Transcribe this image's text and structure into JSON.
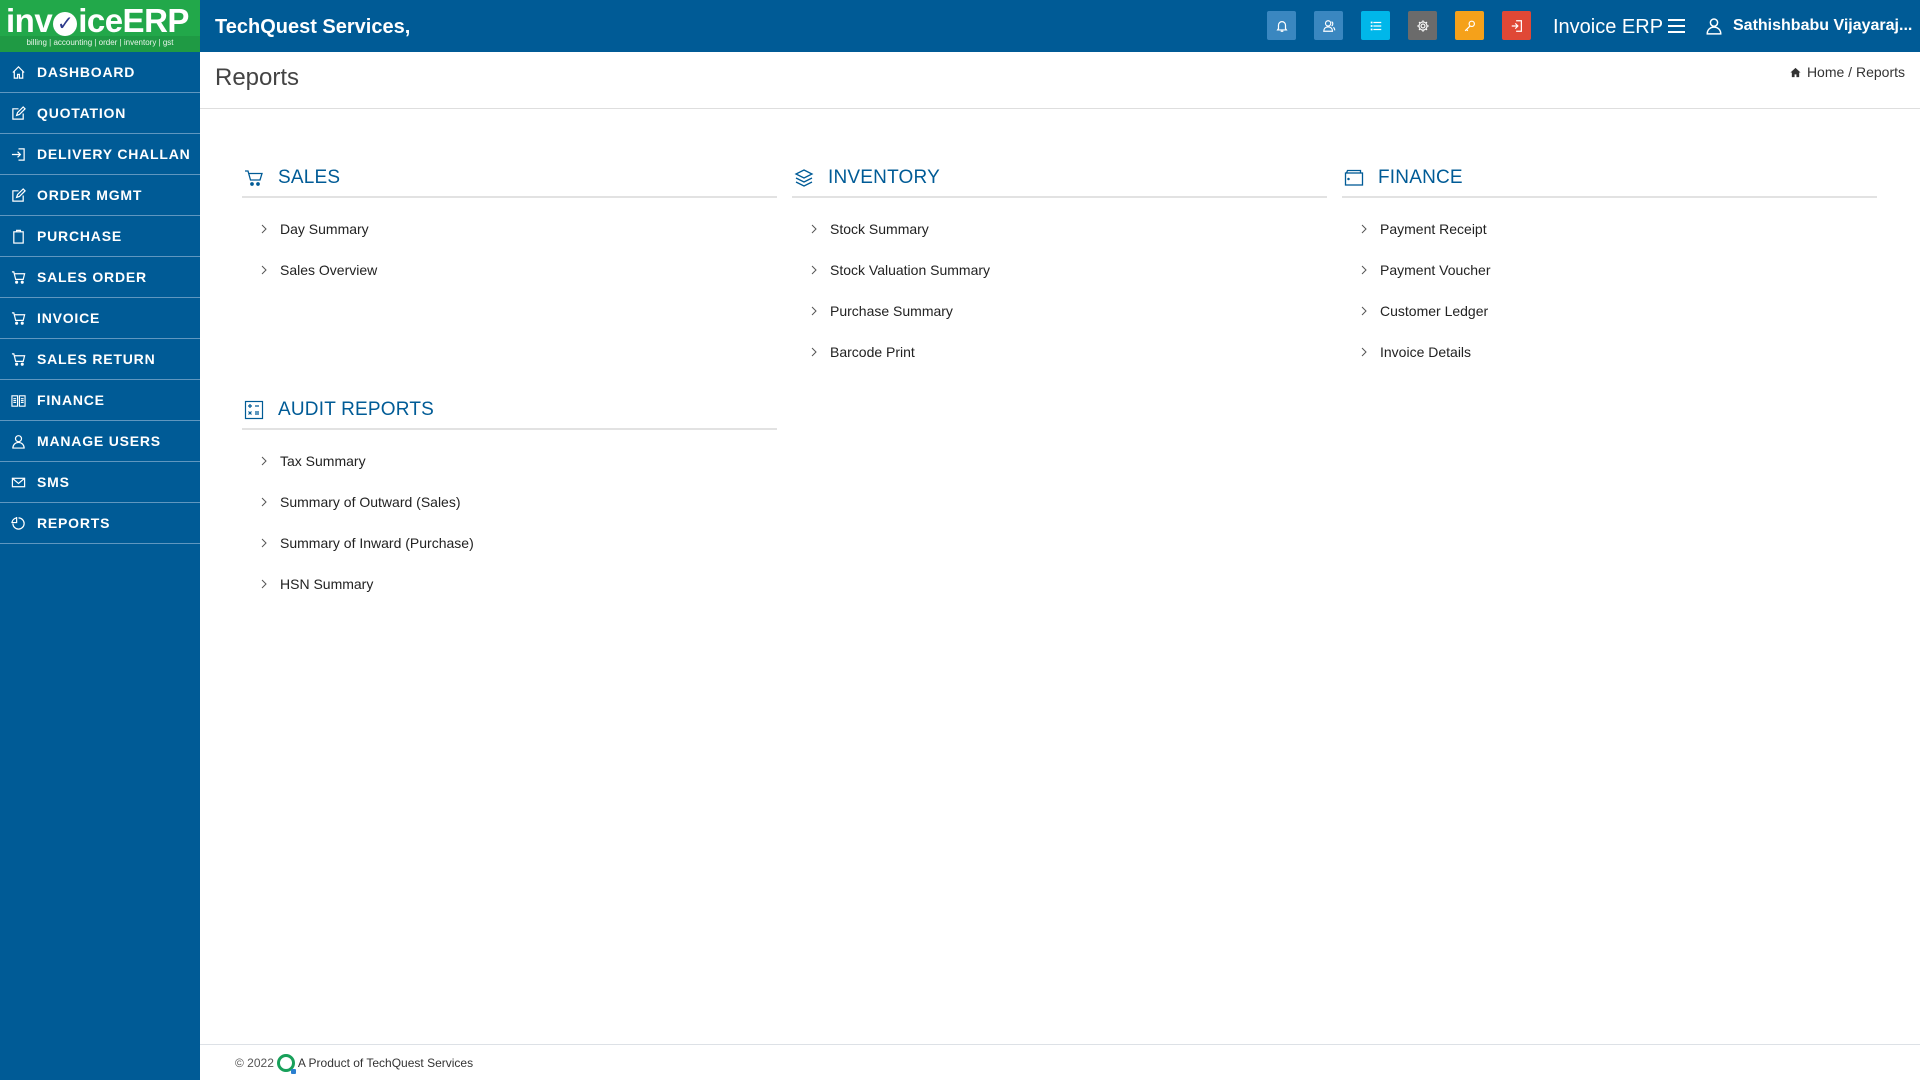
{
  "header": {
    "logo": {
      "main": "invoiceERP",
      "tagline": "billing | accounting | order | inventory | gst"
    },
    "company": "TechQuest Services,",
    "toolbar": [
      {
        "name": "notifications-button",
        "icon": "bell-icon",
        "color": "#3a87c0"
      },
      {
        "name": "users-button",
        "icon": "users-icon",
        "color": "#3a87c0"
      },
      {
        "name": "list-button",
        "icon": "list-icon",
        "color": "#00b7ea"
      },
      {
        "name": "settings-button",
        "icon": "gear-icon",
        "color": "#6b6b6b"
      },
      {
        "name": "password-button",
        "icon": "key-icon",
        "color": "#f5a11a"
      },
      {
        "name": "logout-button",
        "icon": "logout-icon",
        "color": "#e04836"
      }
    ],
    "app_name": "Invoice ERP",
    "user_name": "Sathishbabu Vijayaraj..."
  },
  "sidebar": {
    "items": [
      {
        "label": "DASHBOARD",
        "icon": "home-icon"
      },
      {
        "label": "QUOTATION",
        "icon": "edit-icon"
      },
      {
        "label": "DELIVERY CHALLAN",
        "icon": "sign-in-icon"
      },
      {
        "label": "ORDER MGMT",
        "icon": "edit-icon"
      },
      {
        "label": "PURCHASE",
        "icon": "clipboard-icon"
      },
      {
        "label": "SALES ORDER",
        "icon": "cart-icon"
      },
      {
        "label": "INVOICE",
        "icon": "cart-icon"
      },
      {
        "label": "SALES RETURN",
        "icon": "cart-icon"
      },
      {
        "label": "FINANCE",
        "icon": "book-icon"
      },
      {
        "label": "MANAGE USERS",
        "icon": "user-icon"
      },
      {
        "label": "SMS",
        "icon": "envelope-icon"
      },
      {
        "label": "REPORTS",
        "icon": "pie-chart-icon"
      }
    ]
  },
  "page": {
    "title": "Reports",
    "breadcrumb": {
      "home": "Home",
      "separator": " / ",
      "current": "Reports"
    }
  },
  "sections": {
    "sales": {
      "title": "SALES",
      "icon": "cart-icon",
      "items": [
        "Day Summary",
        "Sales Overview"
      ]
    },
    "inventory": {
      "title": "INVENTORY",
      "icon": "layers-icon",
      "items": [
        "Stock Summary",
        "Stock Valuation Summary",
        "Purchase Summary",
        "Barcode Print"
      ]
    },
    "finance": {
      "title": "FINANCE",
      "icon": "wallet-icon",
      "items": [
        "Payment Receipt",
        "Payment Voucher",
        "Customer Ledger",
        "Invoice Details"
      ]
    },
    "audit": {
      "title": "AUDIT REPORTS",
      "icon": "calculator-icon",
      "items": [
        "Tax Summary",
        "Summary of Outward (Sales)",
        "Summary of Inward (Purchase)",
        "HSN Summary"
      ]
    }
  },
  "footer": {
    "copyright": "© 2022",
    "text": "A Product of TechQuest Services"
  },
  "colors": {
    "primary": "#005b96",
    "logo_bg": "#22a84a",
    "heading": "#005b96"
  }
}
